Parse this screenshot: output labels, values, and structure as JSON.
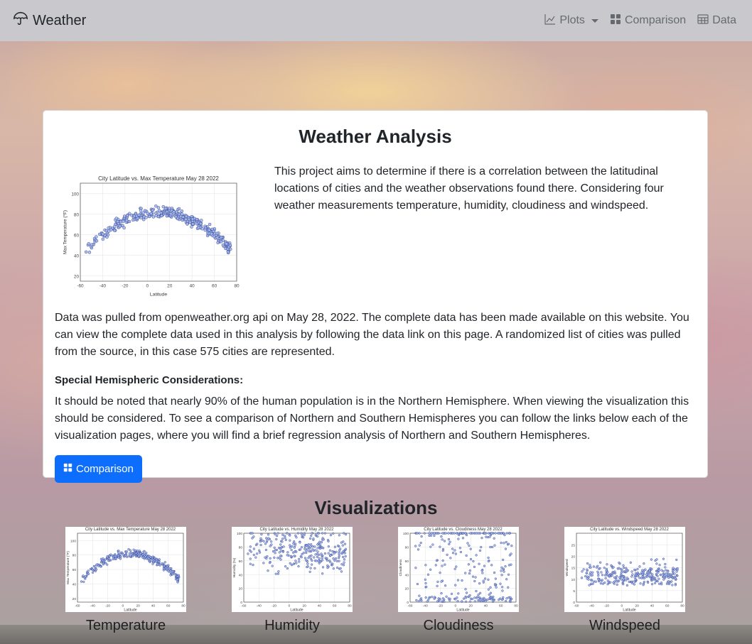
{
  "navbar": {
    "brand": "Weather",
    "items": [
      {
        "label": "Plots",
        "icon": "chart-line-icon",
        "dropdown": true
      },
      {
        "label": "Comparison",
        "icon": "grid-icon"
      },
      {
        "label": "Data",
        "icon": "table-icon"
      }
    ]
  },
  "card": {
    "title": "Weather Analysis",
    "intro": "This project aims to determine if there is a correlation between the latitudinal locations of cities and the weather observations found there. Considering four weather measurements temperature, humidity, cloudiness and windspeed.",
    "data_paragraph": "Data was pulled from openweather.org api on May 28, 2022. The complete data has been made available on this website. You can view the complete data used in this analysis by following the data link on this page. A randomized list of cities was pulled from the source, in this case 575 cities are represented.",
    "special_heading": "Special Hemispheric Considerations:",
    "special_paragraph": "It should be noted that nearly 90% of the human population is in the Northern Hemisphere. When viewing the visualization this should be considered. To see a comparison of Northern and Southern Hemispheres you can follow the links below each of the visualization pages, where you will find a brief regression analysis of Northern and Southern Hemispheres.",
    "button_label": "Comparison"
  },
  "visualizations": {
    "title": "Visualizations",
    "items": [
      {
        "label": "Temperature",
        "chart_title": "City Latitude vs. Max Temperature May 28 2022",
        "ylabel": "Max Temperature (°F)"
      },
      {
        "label": "Humidity",
        "chart_title": "City Latitude vs. Humidity May 28 2022",
        "ylabel": "Humidity (%)"
      },
      {
        "label": "Cloudiness",
        "chart_title": "City Latitude vs. Cloudiness May 28 2022",
        "ylabel": "Cloudiness"
      },
      {
        "label": "Windspeed",
        "chart_title": "City Latitude vs. Windspeed May 28 2022",
        "ylabel": "Windspeed"
      }
    ]
  },
  "chart_data": [
    {
      "type": "scatter",
      "title": "City Latitude vs. Max Temperature May 28 2022",
      "xlabel": "Latitude",
      "ylabel": "Max Temperature (°F)",
      "xlim": [
        -60,
        80
      ],
      "ylim": [
        15,
        110
      ],
      "xticks": [
        -60,
        -40,
        -20,
        0,
        20,
        40,
        60,
        80
      ],
      "yticks": [
        20,
        40,
        60,
        80,
        100
      ],
      "grid": true,
      "trend": "temperature peaks near latitude 0–20 at ~80–100°F and falls toward both poles"
    },
    {
      "type": "scatter",
      "title": "City Latitude vs. Humidity May 28 2022",
      "xlabel": "Latitude",
      "ylabel": "Humidity (%)",
      "xlim": [
        -60,
        80
      ],
      "ylim": [
        0,
        100
      ],
      "grid": true
    },
    {
      "type": "scatter",
      "title": "City Latitude vs. Cloudiness May 28 2022",
      "xlabel": "Latitude",
      "ylabel": "Cloudiness",
      "xlim": [
        -60,
        80
      ],
      "ylim": [
        0,
        100
      ],
      "grid": true
    },
    {
      "type": "scatter",
      "title": "City Latitude vs. Windspeed May 28 2022",
      "xlabel": "Latitude",
      "ylabel": "Windspeed",
      "xlim": [
        -60,
        80
      ],
      "ylim": [
        0,
        30
      ],
      "grid": true
    }
  ],
  "colors": {
    "navbar_bg": "#c9c9cd",
    "button_bg": "#0d6efd",
    "point_fill": "#a8b8e8",
    "point_edge": "#2b3f9a"
  }
}
